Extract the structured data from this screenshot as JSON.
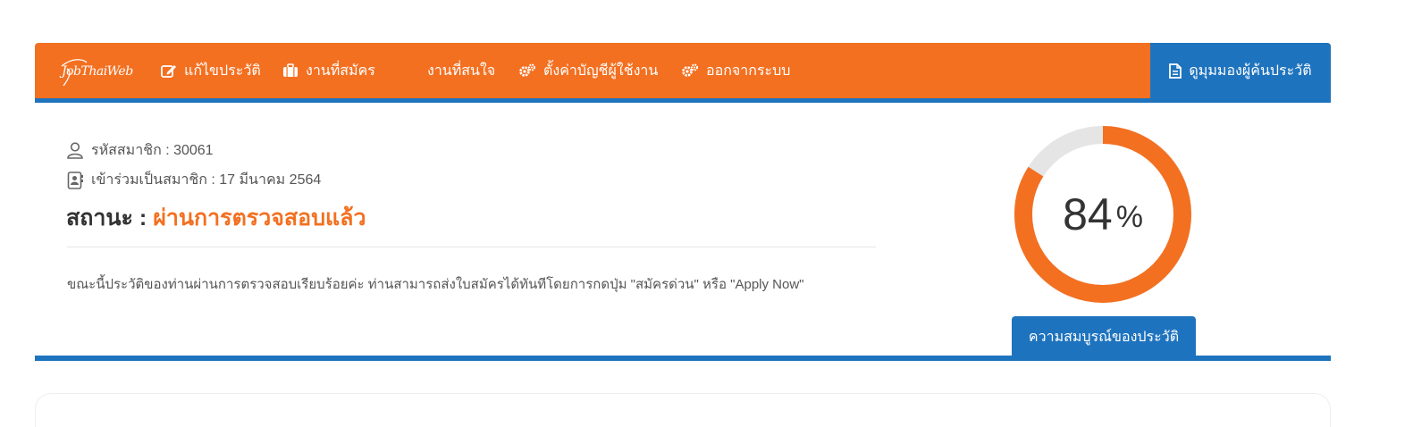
{
  "navbar": {
    "logo": "JobThaiWeb",
    "items": [
      {
        "label": "แก้ไขประวัติ",
        "icon": "edit-icon"
      },
      {
        "label": "งานที่สมัคร",
        "icon": "briefcase-icon"
      },
      {
        "label": "งานที่สนใจ",
        "icon": "heart-icon"
      },
      {
        "label": "ตั้งค่าบัญชีผู้ใช้งาน",
        "icon": "gears-icon"
      },
      {
        "label": "ออกจากระบบ",
        "icon": "gears-icon"
      }
    ],
    "cv_button": {
      "label": "ดูมุมมองผู้ค้นประวัติ",
      "icon": "document-icon"
    }
  },
  "profile": {
    "member_id": "รหัสสมาชิก : 30061",
    "joined": "เข้าร่วมเป็นสมาชิก : 17 มีนาคม 2564",
    "status_label": "สถานะ :",
    "status_value": "ผ่านการตรวจสอบแล้ว",
    "message": "ขณะนี้ประวัติของท่านผ่านการตรวจสอบเรียบร้อยค่ะ ท่านสามารถส่งใบสมัครได้ทันทีโดยการกดปุ่ม \"สมัครด่วน\" หรือ \"Apply Now\""
  },
  "completeness": {
    "value": 84,
    "unit": "%",
    "button_label": "ความสมบูรณ์ของประวัติ",
    "color": "#f37021",
    "track_color": "#e5e5e5"
  },
  "colors": {
    "orange": "#f37021",
    "blue": "#1e73be"
  }
}
